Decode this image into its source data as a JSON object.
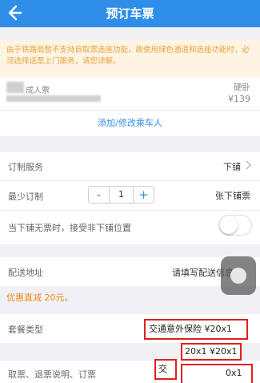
{
  "header": {
    "title": "预订车票",
    "back_icon": "arrow-left-icon"
  },
  "notice": {
    "text": "由于铁路局暂不支持自取票选座功能，故使用绿色通道和选座功能时，必须选择送票上门服务，请您谅解。"
  },
  "passenger": {
    "ticket_type": "成人票",
    "seat_type": "硬卧",
    "price": "¥139",
    "add_label": "添加/修改乘车人"
  },
  "service": {
    "label": "订制服务",
    "value": "下铺",
    "min_label": "最少订制",
    "min_value": "1",
    "minus": "-",
    "plus": "+",
    "min_right": "张下铺票",
    "toggle_label": "当下铺无票时，接受非下铺位置",
    "toggle_on": false
  },
  "delivery": {
    "label": "配送地址",
    "value": "请填写配送信息"
  },
  "discount": {
    "text": "优惠直减 20元。"
  },
  "package": {
    "label": "套餐类型",
    "selected": "交通意外保险 ¥20x1",
    "options": [
      "20x1 ¥20x1",
      "交",
      "0x1"
    ]
  },
  "bottom": {
    "text": "取票、退票说明、订票"
  },
  "colors": {
    "primary": "#2f8fe8",
    "notice_text": "#e9a23b",
    "notice_bg": "#fdf4e3",
    "discount": "#f08a1c",
    "highlight_border": "#e02020"
  }
}
